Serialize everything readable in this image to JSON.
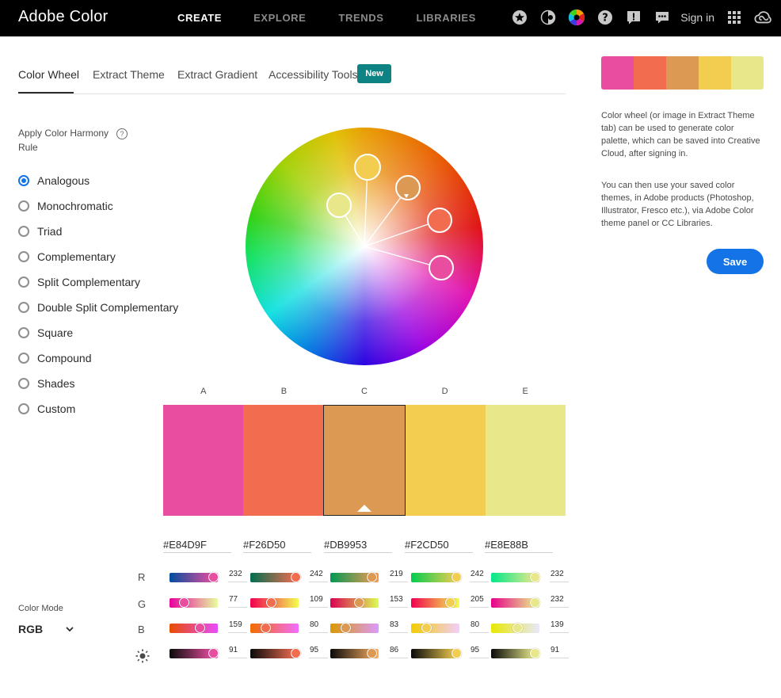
{
  "topbar": {
    "brand": "Adobe Color",
    "nav": [
      "CREATE",
      "EXPLORE",
      "TRENDS",
      "LIBRARIES"
    ],
    "signin": "Sign in"
  },
  "tabs": {
    "items": [
      "Color Wheel",
      "Extract Theme",
      "Extract Gradient",
      "Accessibility Tools"
    ],
    "badge": "New"
  },
  "harmony": {
    "label": "Apply Color Harmony Rule",
    "help": "?",
    "rules": [
      "Analogous",
      "Monochromatic",
      "Triad",
      "Complementary",
      "Split Complementary",
      "Double Split Complementary",
      "Square",
      "Compound",
      "Shades",
      "Custom"
    ],
    "selected_index": 0
  },
  "swatches": {
    "letters": [
      "A",
      "B",
      "C",
      "D",
      "E"
    ],
    "colors": [
      "#E84D9F",
      "#F26D50",
      "#DB9953",
      "#F2CD50",
      "#E8E88B"
    ],
    "hex": [
      "#E84D9F",
      "#F26D50",
      "#DB9953",
      "#F2CD50",
      "#E8E88B"
    ],
    "selected_index": 2
  },
  "channels": {
    "labels": [
      "R",
      "G",
      "B"
    ],
    "brightness_icon": "sun-icon",
    "values": {
      "R": [
        232,
        242,
        219,
        242,
        232
      ],
      "G": [
        77,
        109,
        153,
        205,
        232
      ],
      "B": [
        159,
        80,
        83,
        80,
        139
      ],
      "brightness": [
        91,
        95,
        86,
        95,
        91
      ]
    }
  },
  "color_mode": {
    "label": "Color Mode",
    "value": "RGB"
  },
  "right_panel": {
    "info_1": "Color wheel (or image in Extract Theme tab) can be used to generate color palette, which can be saved into Creative Cloud, after signing in.",
    "info_2": "You can then use your saved color themes, in Adobe products (Photoshop, Illustrator, Fresco etc.), via Adobe Color theme panel or CC Libraries.",
    "save": "Save"
  },
  "icons": [
    "star-icon",
    "contrast-icon",
    "color-wheel-icon",
    "help-icon",
    "feedback-icon",
    "chat-icon",
    "apps-grid-icon",
    "creative-cloud-icon"
  ]
}
